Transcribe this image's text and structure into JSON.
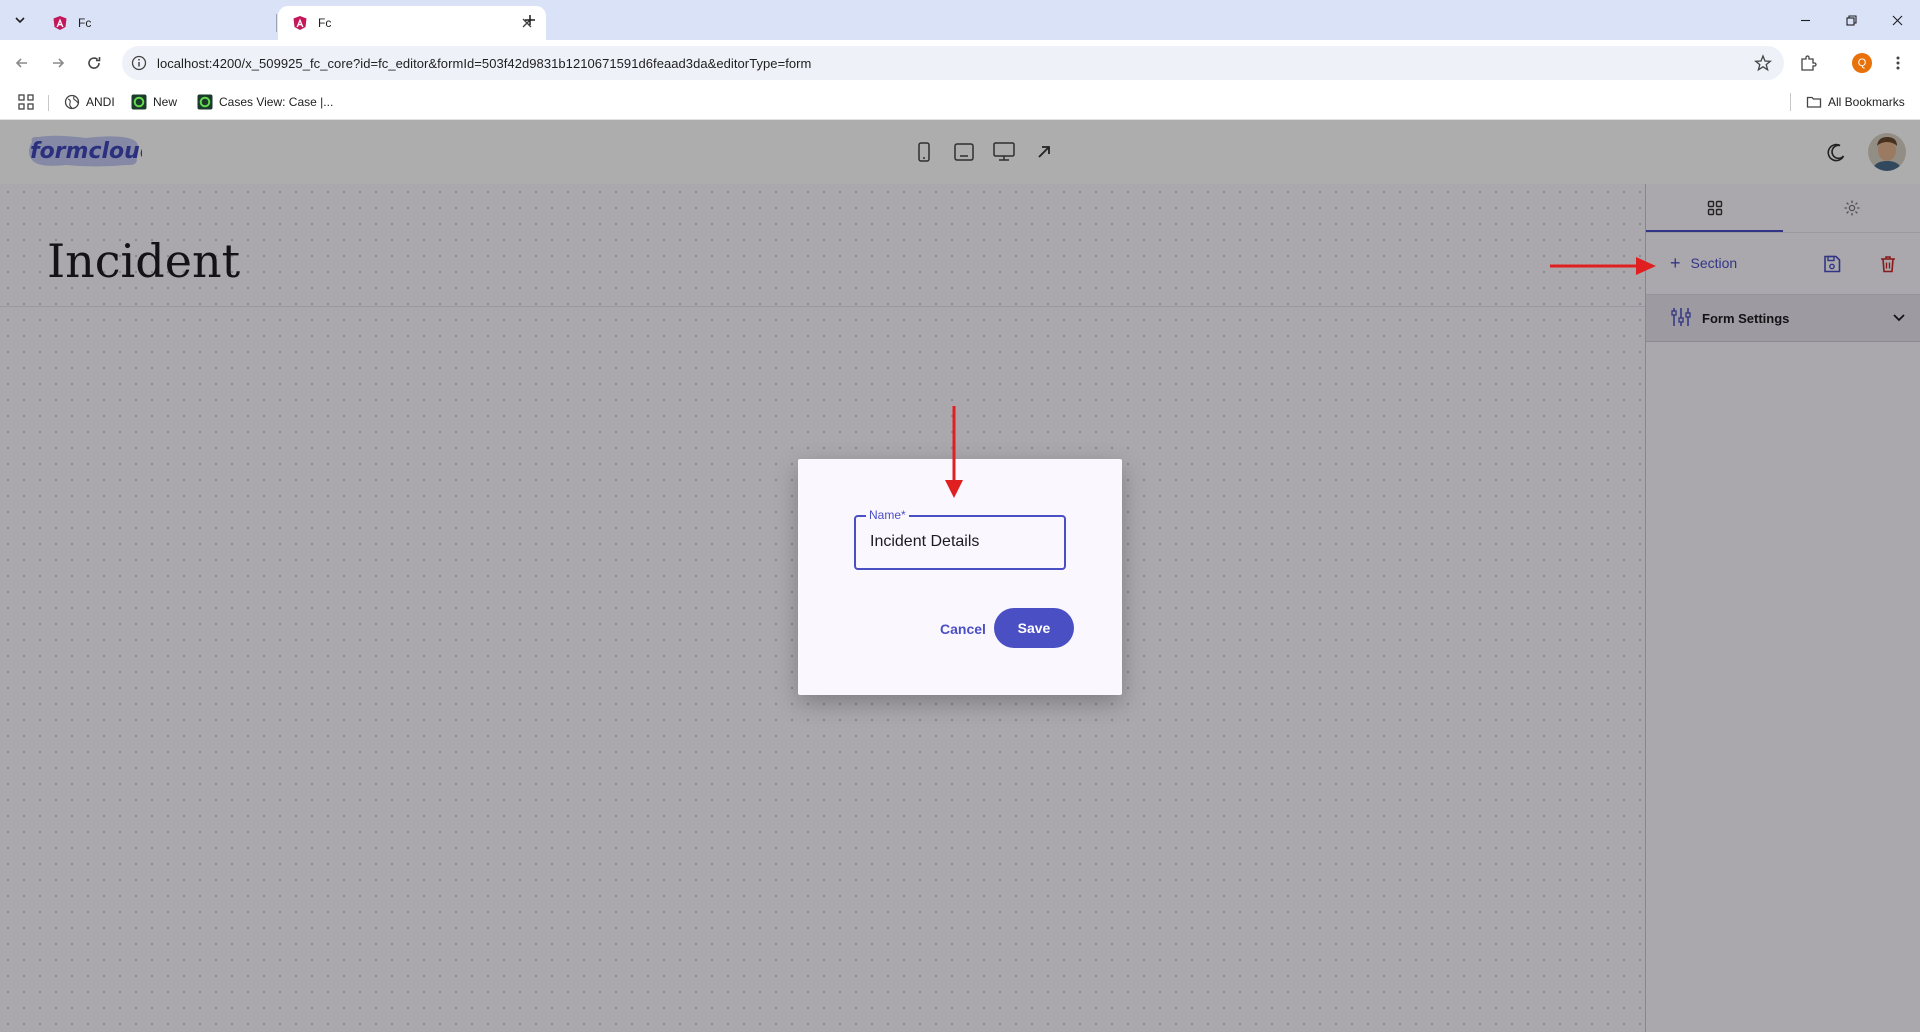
{
  "browser": {
    "tabs": [
      {
        "title": "Fc",
        "active": false
      },
      {
        "title": "Fc",
        "active": true
      }
    ],
    "url": "localhost:4200/x_509925_fc_core?id=fc_editor&formId=503f42d9831b1210671591d6feaad3da&editorType=form",
    "profile_initial": "Q",
    "bookmarks": [
      {
        "label": "ANDI"
      },
      {
        "label": "New"
      },
      {
        "label": "Cases View: Case |..."
      }
    ],
    "all_bookmarks": "All Bookmarks"
  },
  "app": {
    "logo_text": "formcloud",
    "form_title": "Incident",
    "panel": {
      "add_section_label": "Section",
      "form_settings_label": "Form Settings"
    }
  },
  "dialog": {
    "field_label": "Name*",
    "field_value": "Incident Details",
    "cancel_label": "Cancel",
    "save_label": "Save"
  },
  "colors": {
    "primary": "#4a4fc4",
    "danger": "#c62828",
    "annotation_arrow": "#e02020"
  }
}
